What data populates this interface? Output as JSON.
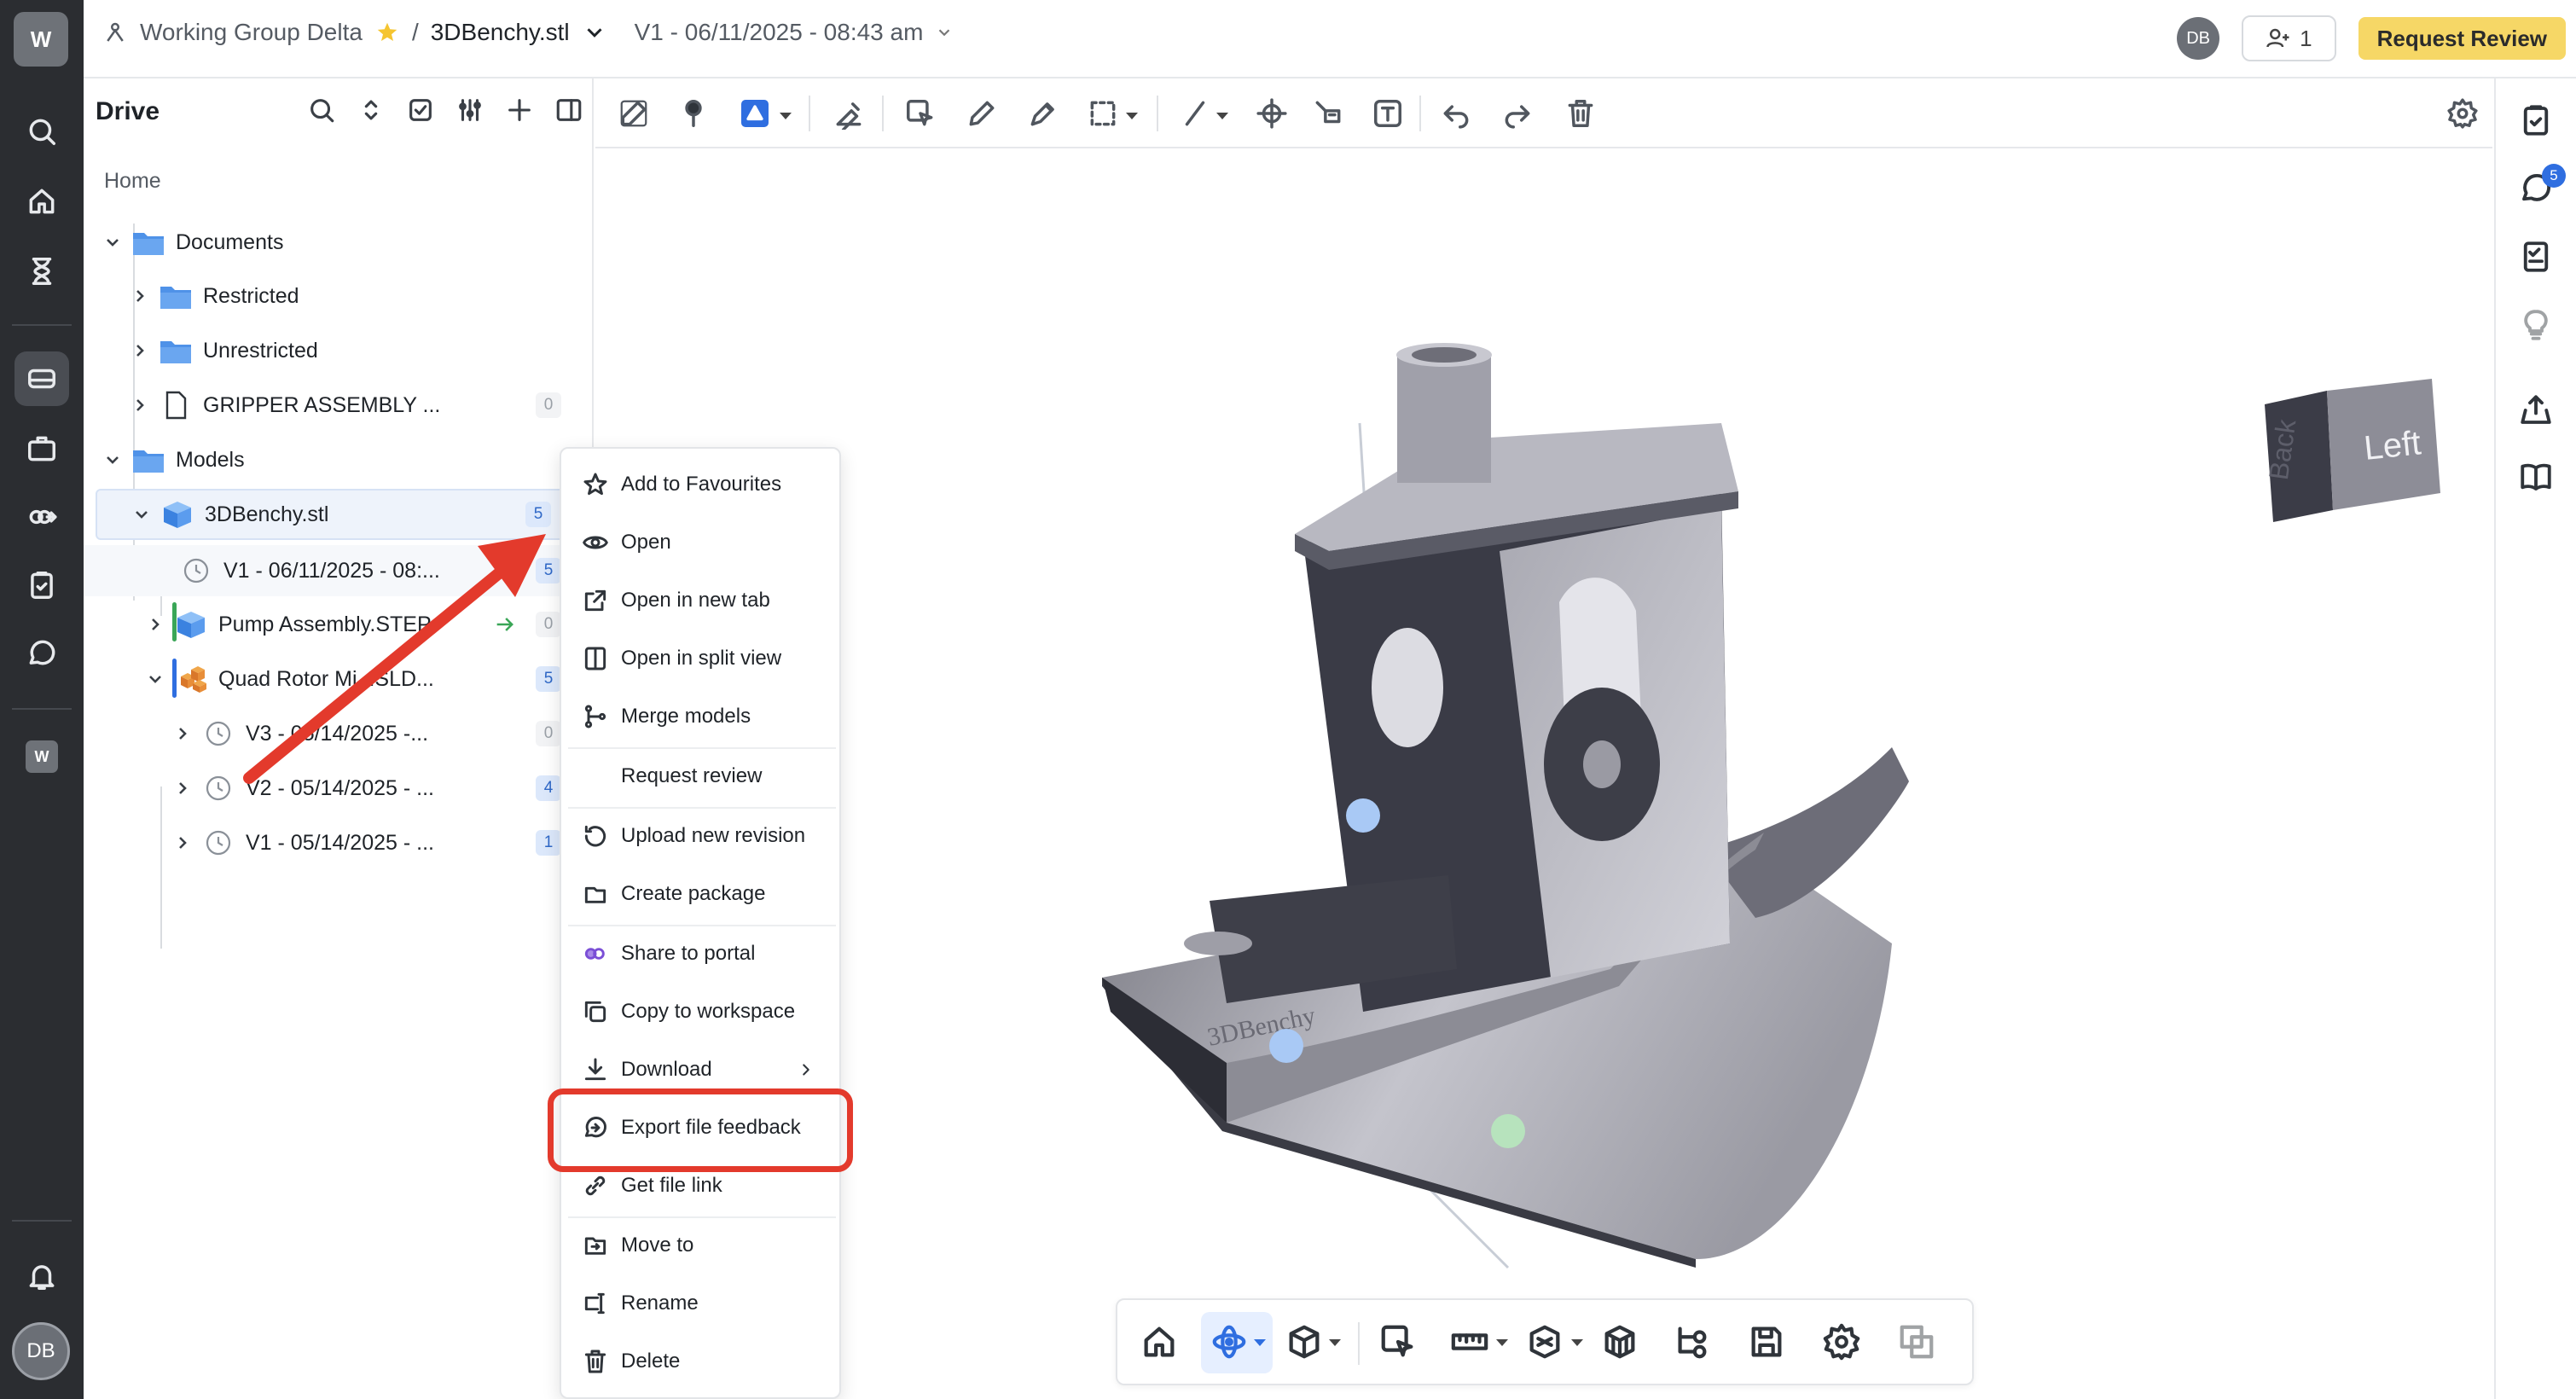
{
  "workspace": {
    "initial": "W",
    "name": "Working Group Delta"
  },
  "breadcrumb": {
    "file": "3DBenchy.stl",
    "version": "V1 - 06/11/2025 - 08:43 am",
    "separator": "/"
  },
  "header": {
    "user_initials": "DB",
    "share_count": "1",
    "request_review_label": "Request Review"
  },
  "rail": {
    "secondary_workspace": "W",
    "user_initials": "DB"
  },
  "drive": {
    "title": "Drive",
    "home_label": "Home",
    "tree": [
      {
        "label": "Documents",
        "type": "folder",
        "expanded": true
      },
      {
        "label": "Restricted",
        "type": "folder",
        "expanded": false
      },
      {
        "label": "Unrestricted",
        "type": "folder",
        "expanded": false
      },
      {
        "label": "GRIPPER ASSEMBLY ...",
        "type": "document",
        "badge": "0"
      },
      {
        "label": "Models",
        "type": "folder",
        "expanded": true
      },
      {
        "label": "3DBenchy.stl",
        "type": "model",
        "badge": "5",
        "selected": true
      },
      {
        "label": "V1 - 06/11/2025 - 08:...",
        "type": "version",
        "badge": "5"
      },
      {
        "label": "Pump Assembly.STEP",
        "type": "model",
        "badge": "0"
      },
      {
        "label": "Quad Rotor Mi...SLD...",
        "type": "assembly",
        "badge": "5"
      },
      {
        "label": "V3 - 05/14/2025 -...",
        "type": "version",
        "badge": "0"
      },
      {
        "label": "V2 - 05/14/2025 - ...",
        "type": "version",
        "badge": "4"
      },
      {
        "label": "V1 - 05/14/2025 - ...",
        "type": "version",
        "badge": "1"
      }
    ]
  },
  "context_menu": {
    "items": [
      {
        "label": "Add to Favourites",
        "icon": "star-icon"
      },
      {
        "label": "Open",
        "icon": "eye-icon"
      },
      {
        "label": "Open in new tab",
        "icon": "external-link-icon"
      },
      {
        "label": "Open in split view",
        "icon": "split-view-icon"
      },
      {
        "label": "Merge models",
        "icon": "merge-icon"
      },
      {
        "label": "Request review",
        "icon": "request-review-icon"
      },
      {
        "label": "Upload new revision",
        "icon": "revision-icon"
      },
      {
        "label": "Create package",
        "icon": "package-icon"
      },
      {
        "label": "Share to portal",
        "icon": "portal-icon"
      },
      {
        "label": "Copy to workspace",
        "icon": "copy-icon"
      },
      {
        "label": "Download",
        "icon": "download-icon"
      },
      {
        "label": "Export file feedback",
        "icon": "export-feedback-icon"
      },
      {
        "label": "Get file link",
        "icon": "link-icon"
      },
      {
        "label": "Move to",
        "icon": "move-icon"
      },
      {
        "label": "Rename",
        "icon": "rename-icon"
      },
      {
        "label": "Delete",
        "icon": "trash-icon"
      }
    ]
  },
  "viewer": {
    "view_cube": {
      "front_face": "Left",
      "side_face": "Back"
    },
    "model_label": "3DBenchy"
  },
  "right_rail": {
    "notification_count": "5"
  },
  "colors": {
    "accent": "#2f6ee0",
    "highlight": "#e33a2c",
    "review_button": "#f6d766",
    "rail": "#2b2d31"
  }
}
